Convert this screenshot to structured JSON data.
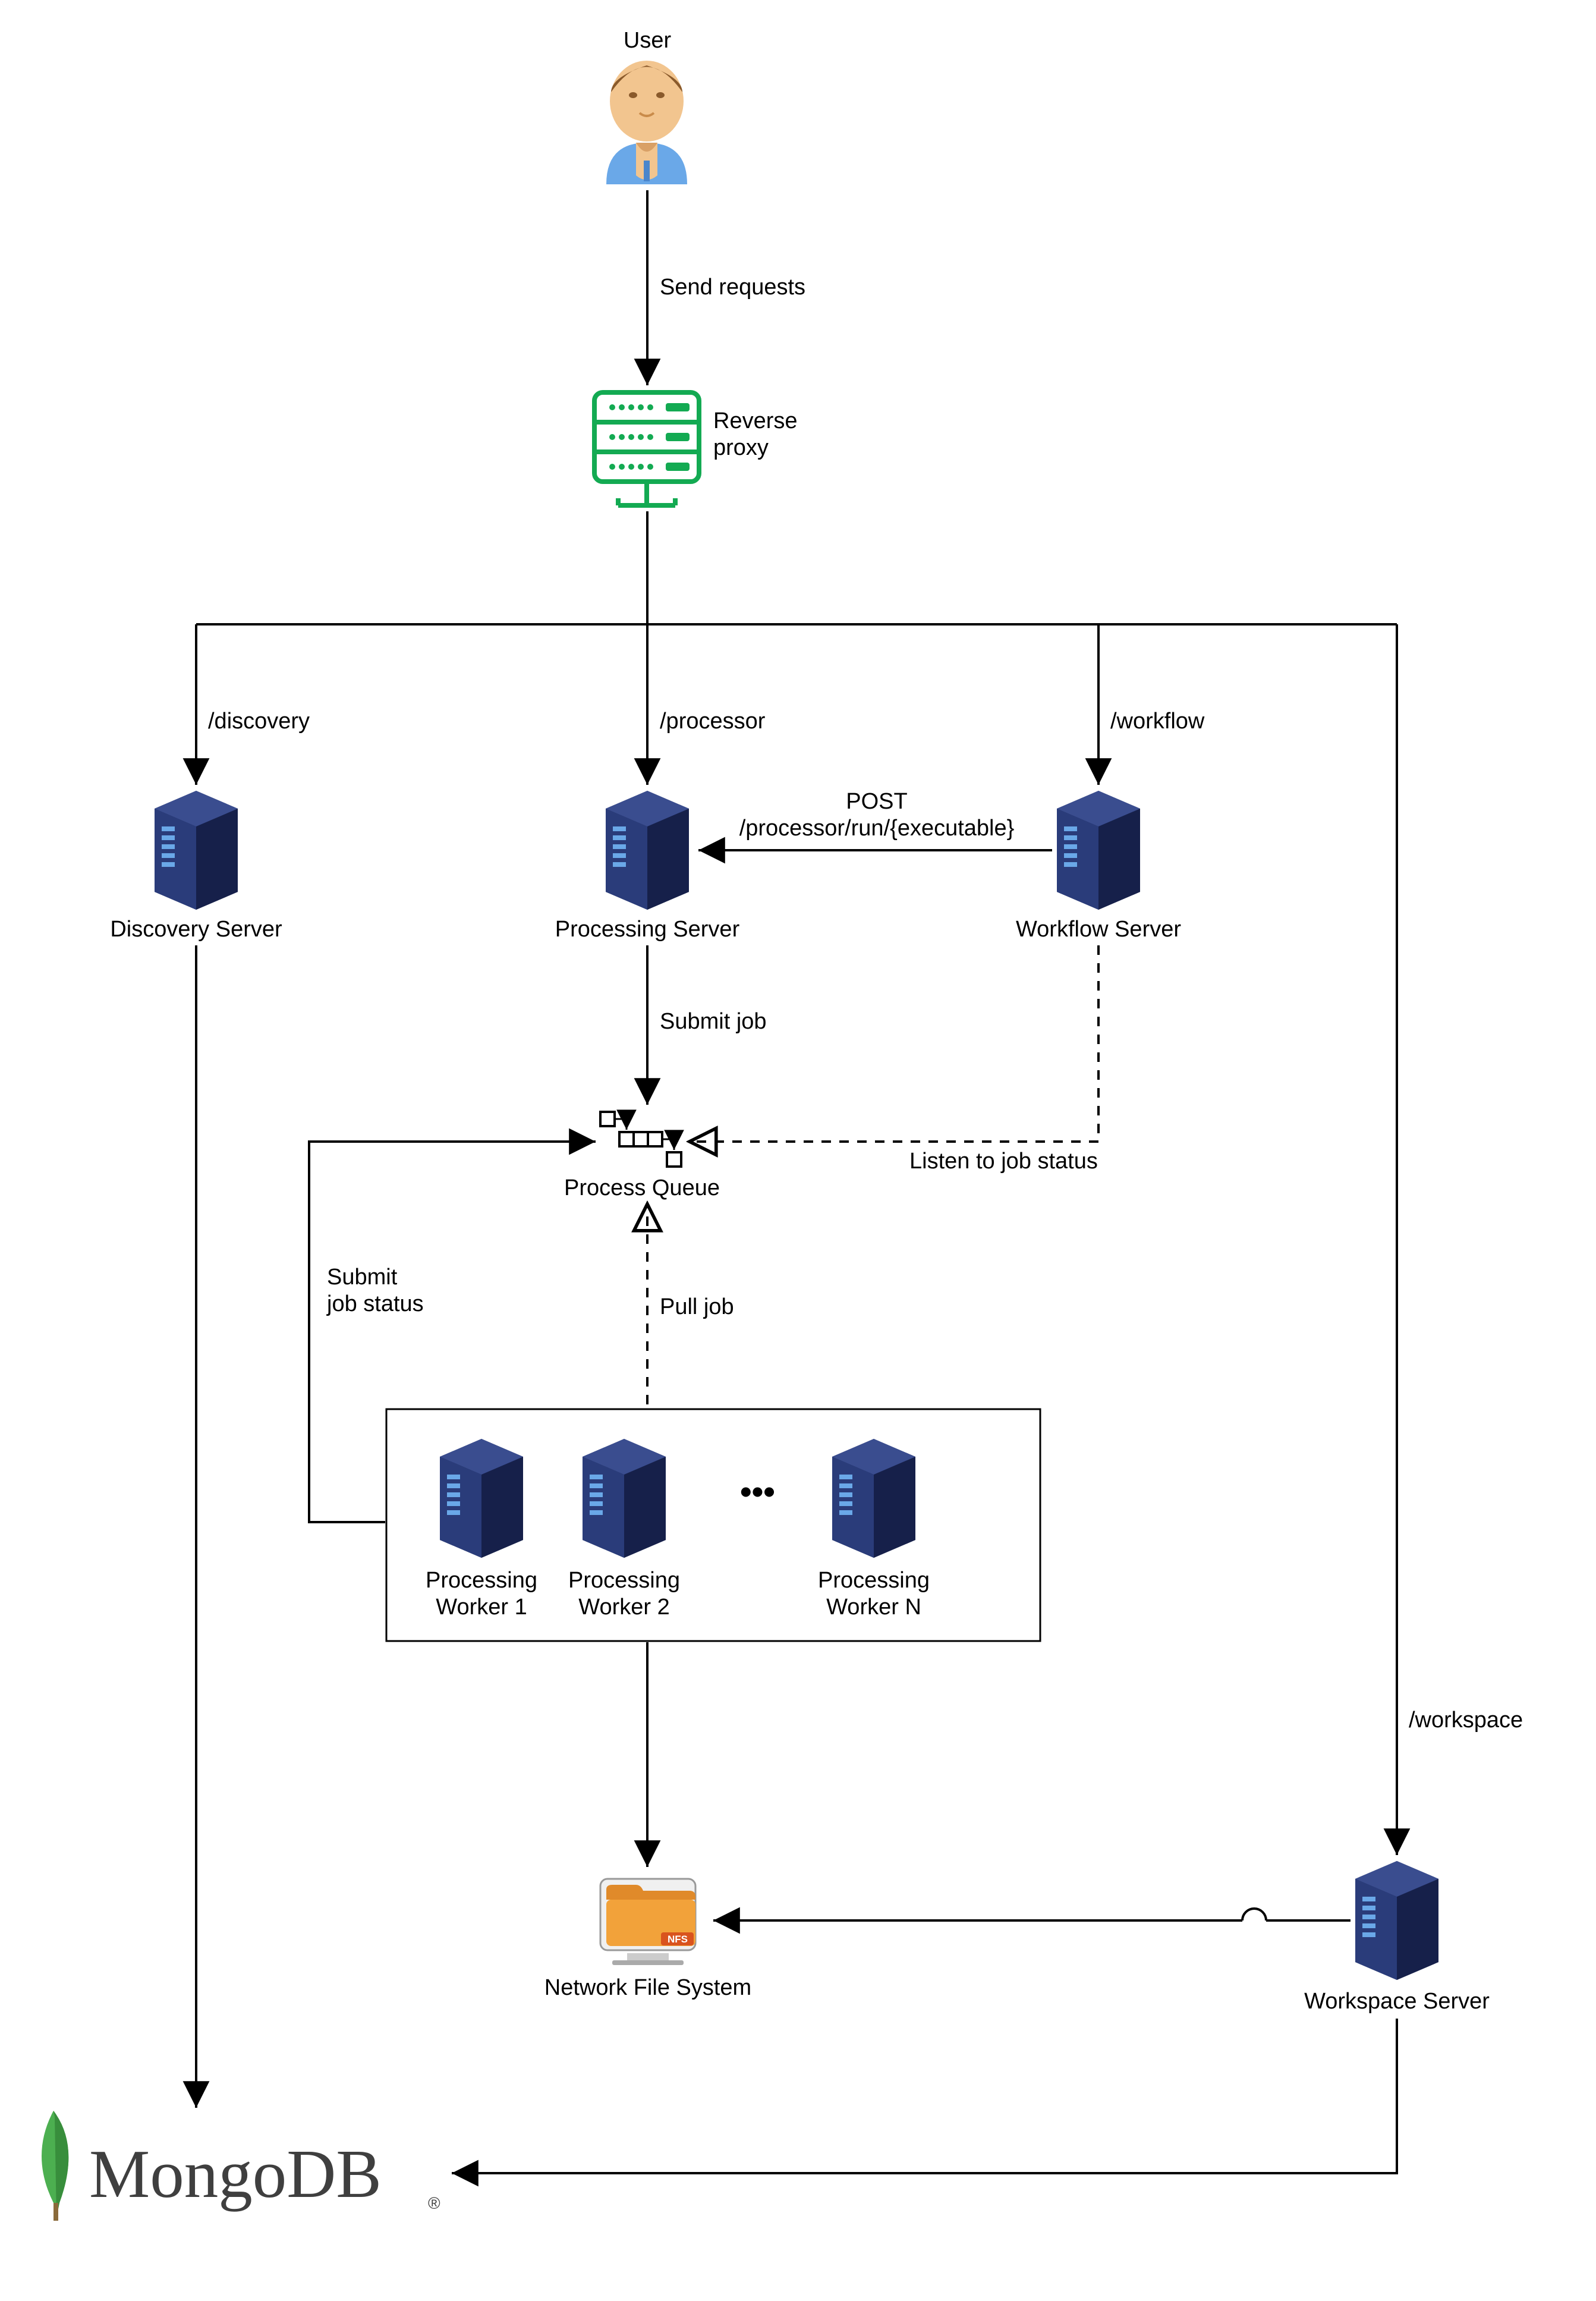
{
  "nodes": {
    "user": "User",
    "reverse_proxy": "Reverse\nproxy",
    "discovery_server": "Discovery Server",
    "processing_server": "Processing Server",
    "workflow_server": "Workflow Server",
    "process_queue": "Process Queue",
    "worker1": "Processing\nWorker 1",
    "worker2": "Processing\nWorker 2",
    "ellipsis": "•••",
    "workerN": "Processing\nWorker N",
    "nfs": "Network File System",
    "nfs_badge": "NFS",
    "workspace_server": "Workspace Server",
    "mongodb": "MongoDB",
    "mongodb_r": "®"
  },
  "edges": {
    "send_requests": "Send requests",
    "discovery": "/discovery",
    "processor": "/processor",
    "workflow": "/workflow",
    "post": "POST\n/processor/run/{executable}",
    "submit_job": "Submit job",
    "listen": "Listen to job status",
    "pull_job": "Pull job",
    "submit_job_status": "Submit\njob status",
    "workspace": "/workspace"
  }
}
